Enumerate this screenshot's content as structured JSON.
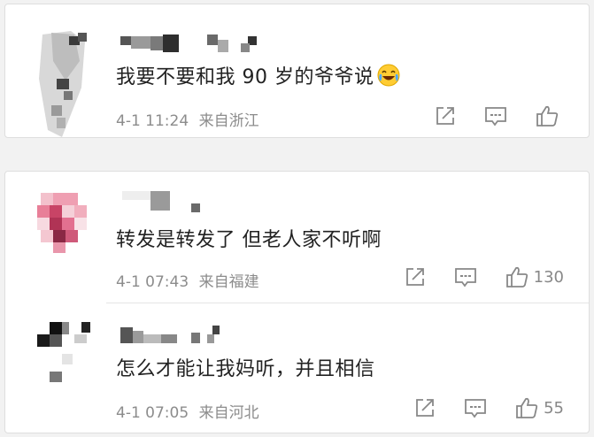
{
  "comments": [
    {
      "username": "",
      "text": "我要不要和我 90 岁的爷爷说",
      "emoji": "laughing-crying-emoji",
      "date": "4-1 11:24",
      "location": "来自浙江",
      "like_count": ""
    },
    {
      "username": "",
      "text": "转发是转发了 但老人家不听啊",
      "date": "4-1 07:43",
      "location": "来自福建",
      "like_count": "130"
    },
    {
      "username": "",
      "text": "怎么才能让我妈听，并且相信",
      "date": "4-1 07:05",
      "location": "来自河北",
      "like_count": "55"
    }
  ],
  "icons": {
    "share": "share-icon",
    "comment": "comment-icon",
    "like": "thumbs-up-icon"
  },
  "colors": {
    "background": "#f2f2f2",
    "card": "#ffffff",
    "text": "#222222",
    "meta": "#8c8c8c",
    "icon": "#888888"
  }
}
